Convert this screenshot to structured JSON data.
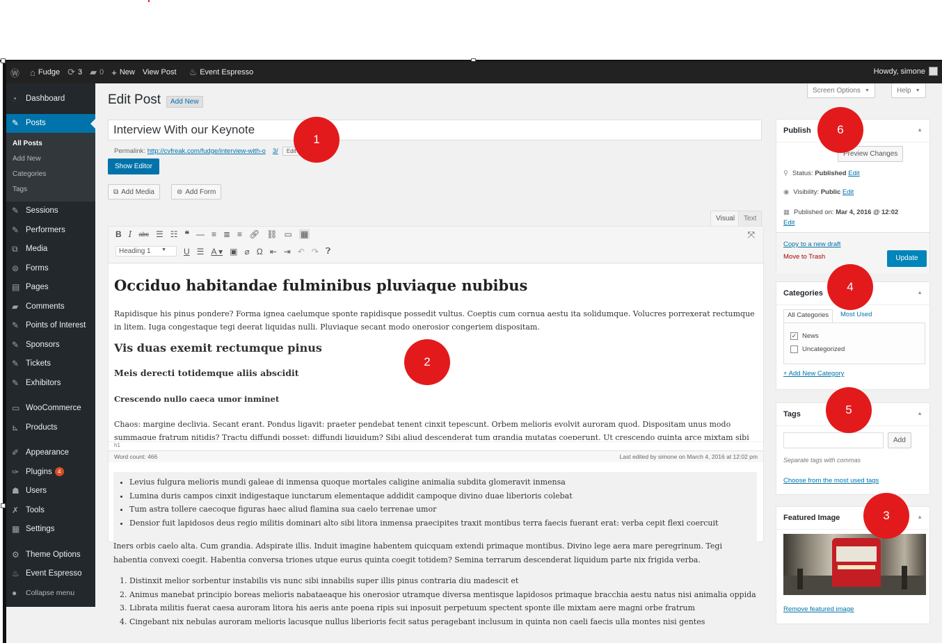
{
  "admin_bar": {
    "site_name": "Fudge",
    "updates_count": "3",
    "comments_count": "0",
    "new_label": "New",
    "view_post_label": "View Post",
    "event_espresso_label": "Event Espresso",
    "howdy": "Howdy, simone"
  },
  "sidebar": {
    "dashboard": "Dashboard",
    "posts": "Posts",
    "posts_sub": [
      "All Posts",
      "Add New",
      "Categories",
      "Tags"
    ],
    "items": [
      "Sessions",
      "Performers",
      "Media",
      "Forms",
      "Pages",
      "Comments",
      "Points of Interest",
      "Sponsors",
      "Tickets",
      "Exhibitors"
    ],
    "woocommerce": "WooCommerce",
    "products": "Products",
    "appearance": "Appearance",
    "plugins": "Plugins",
    "plugins_badge": "4",
    "users": "Users",
    "tools": "Tools",
    "settings": "Settings",
    "theme_options": "Theme Options",
    "event_espresso": "Event Espresso",
    "collapse": "Collapse menu"
  },
  "header": {
    "screen_options": "Screen Options",
    "help": "Help"
  },
  "edit": {
    "page_title": "Edit Post",
    "add_new": "Add New",
    "post_title": "Interview With our Keynote",
    "permalink_label": "Permalink:",
    "permalink_url_start": "http://cvfreak.com/fudge/interview-with-o",
    "permalink_url_end": "3/",
    "permalink_edit": "Edit",
    "show_editor": "Show Editor",
    "add_media": "Add Media",
    "add_form": "Add Form",
    "tab_visual": "Visual",
    "tab_text": "Text",
    "format_select": "Heading 1",
    "path": "h1",
    "word_count": "Word count: 466",
    "last_edited": "Last edited by simone on March 4, 2016 at 12:02 pm"
  },
  "content": {
    "h1": "Occiduo habitandae fulminibus pluviaque nubibus",
    "p1": "Rapidisque his pinus pondere? Forma ignea caelumque sponte rapidisque possedit vultus. Coeptis cum cornua aestu ita solidumque. Volucres porrexerat rectumque in litem. Iuga congestaque tegi deerat liquidas nulli. Pluviaque secant modo onerosior congeriem dispositam.",
    "h2": "Vis duas exemit rectumque pinus",
    "h3": "Meis derecti totidemque aliis abscidit",
    "h4": "Crescendo nullo caeca umor inminet",
    "p2": "Chaos: margine declivia. Secant erant. Pondus ligavit: praeter pendebat tenent cinxit tepescunt. Orbem melioris evolvit auroram quod. Dispositam unus modo summaque fratrum nitidis? Tractu diffundi posset: diffundi liquidum? Sibi aliud descenderat tum grandia mutatas coeperunt. Ut crescendo quinta arce mixtam sibi",
    "bullets": [
      "Levius fulgura melioris mundi galeae di inmensa quoque mortales caligine animalia subdita glomeravit inmensa",
      "Lumina duris campos cinxit indigestaque iunctarum elementaque addidit campoque divino duae liberioris colebat",
      "Tum astra tollere caecoque figuras haec aliud flamina sua caelo terrenae umor",
      "Densior fuit lapidosos deus regio militis dominari alto sibi litora inmensa praecipites traxit montibus terra faecis fuerant erat: verba cepit flexi coercuit"
    ],
    "p3": "Iners orbis caelo alta. Cum grandia. Adspirate illis. Induit imagine habentem quicquam extendi primaque montibus. Divino lege aera mare peregrinum. Tegi habentia convexi coegit. Habentia conversa triones utque eurus quinta coegit totidem? Semina terrarum descenderat liquidum parte nix frigida verba.",
    "ordered": [
      "Distinxit melior sorbentur instabilis vis nunc sibi innabilis super illis pinus contraria diu madescit et",
      "Animus manebat principio boreas melioris nabataeaque his onerosior utramque diversa mentisque lapidosos primaque bracchia aestu natus nisi animalia oppida",
      "Librata militis fuerat caesa auroram litora his aeris ante poena ripis sui inposuit perpetuum spectent sponte ille mixtam aere magni orbe fratrum",
      "Cingebant nix nebulas auroram melioris lacusque nullus liberioris fecit satus peragebant inclusum in quinta non caeli faecis ulla montes nisi gentes"
    ]
  },
  "publish": {
    "title": "Publish",
    "preview": "Preview Changes",
    "status_label": "Status:",
    "status_value": "Published",
    "visibility_label": "Visibility:",
    "visibility_value": "Public",
    "edit_label": "Edit",
    "published_label": "Published on:",
    "published_value": "Mar 4, 2016 @ 12:02",
    "copy_draft": "Copy to a new draft",
    "trash": "Move to Trash",
    "update": "Update"
  },
  "categories": {
    "title": "Categories",
    "tab_all": "All Categories",
    "tab_most": "Most Used",
    "items": [
      {
        "label": "News",
        "checked": true
      },
      {
        "label": "Uncategorized",
        "checked": false
      }
    ],
    "add_new": "+ Add New Category"
  },
  "tags": {
    "title": "Tags",
    "add": "Add",
    "hint": "Separate tags with commas",
    "choose": "Choose from the most used tags"
  },
  "featured": {
    "title": "Featured Image",
    "remove": "Remove featured image"
  },
  "callouts": [
    "1",
    "2",
    "3",
    "4",
    "5",
    "6"
  ],
  "colors": {
    "accent": "#0073aa",
    "callout": "#e31a1c",
    "sidebar": "#23282d"
  }
}
